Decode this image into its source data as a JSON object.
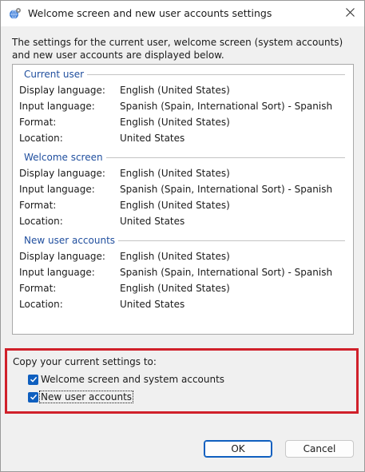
{
  "window": {
    "title": "Welcome screen and new user accounts settings",
    "icons": {
      "app": "globe-gear-icon",
      "close": "close-icon"
    }
  },
  "intro_text": "The settings for the current user, welcome screen (system accounts) and new user accounts are displayed below.",
  "groups": [
    {
      "title": "Current user",
      "rows": [
        {
          "label": "Display language:",
          "value": "English (United States)"
        },
        {
          "label": "Input language:",
          "value": "Spanish (Spain, International Sort) - Spanish"
        },
        {
          "label": "Format:",
          "value": "English (United States)"
        },
        {
          "label": "Location:",
          "value": "United States"
        }
      ]
    },
    {
      "title": "Welcome screen",
      "rows": [
        {
          "label": "Display language:",
          "value": "English (United States)"
        },
        {
          "label": "Input language:",
          "value": "Spanish (Spain, International Sort) - Spanish"
        },
        {
          "label": "Format:",
          "value": "English (United States)"
        },
        {
          "label": "Location:",
          "value": "United States"
        }
      ]
    },
    {
      "title": "New user accounts",
      "rows": [
        {
          "label": "Display language:",
          "value": "English (United States)"
        },
        {
          "label": "Input language:",
          "value": "Spanish (Spain, International Sort) - Spanish"
        },
        {
          "label": "Format:",
          "value": "English (United States)"
        },
        {
          "label": "Location:",
          "value": "United States"
        }
      ]
    }
  ],
  "copy_settings": {
    "label": "Copy your current settings to:",
    "options": [
      {
        "label": "Welcome screen and system accounts",
        "checked": true
      },
      {
        "label": "New user accounts",
        "checked": true
      }
    ]
  },
  "buttons": {
    "ok": "OK",
    "cancel": "Cancel"
  },
  "colors": {
    "group_title": "#1f4e9e",
    "checkbox": "#0f5fbf",
    "highlight_box": "#d0202a"
  }
}
